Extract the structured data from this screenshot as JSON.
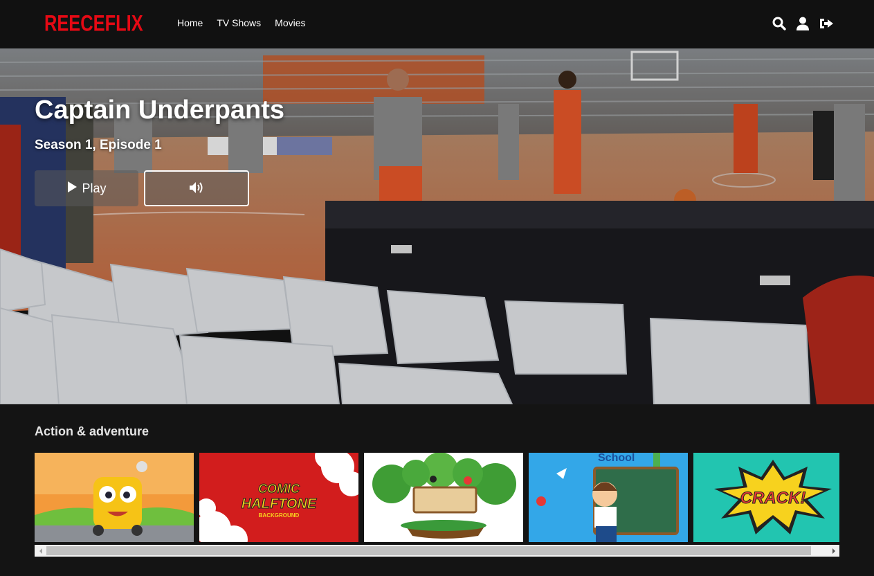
{
  "app": {
    "logo_text": "REECEFLIX",
    "accent_color": "#e50914"
  },
  "nav": {
    "links": [
      {
        "label": "Home"
      },
      {
        "label": "TV Shows"
      },
      {
        "label": "Movies"
      }
    ],
    "icons": [
      "search-icon",
      "user-icon",
      "sign-out-icon"
    ]
  },
  "hero": {
    "title": "Captain Underpants",
    "subtitle": "Season 1, Episode 1",
    "play_label": "Play",
    "play_icon": "play-icon",
    "mute_icon": "volume-icon"
  },
  "row": {
    "title": "Action & adventure",
    "tiles": [
      {
        "name": "cartoon-school-bus"
      },
      {
        "name": "comic-halftone-background",
        "text_line1": "COMIC",
        "text_line2": "HALFTONE",
        "text_line3": "BACKGROUND"
      },
      {
        "name": "jungle-sign-birds"
      },
      {
        "name": "school-boy-chalkboard",
        "text": "School"
      },
      {
        "name": "comic-crack-burst",
        "text": "CRACK!"
      }
    ]
  }
}
